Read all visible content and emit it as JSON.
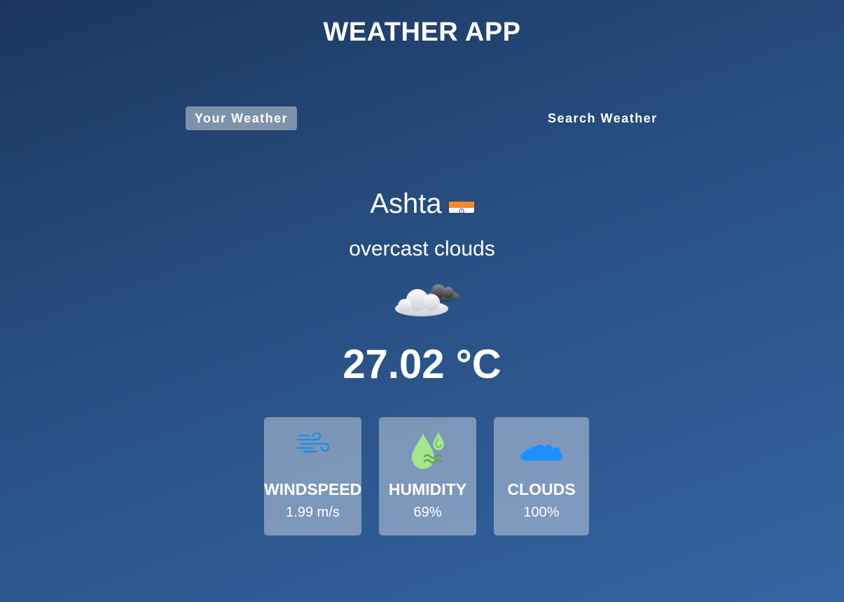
{
  "app": {
    "title": "WEATHER APP"
  },
  "tabs": [
    {
      "label": "Your Weather",
      "active": true
    },
    {
      "label": "Search Weather",
      "active": false
    }
  ],
  "weather": {
    "city": "Ashta",
    "country_flag_icon": "india-flag-icon",
    "description": "overcast clouds",
    "condition_icon": "overcast-clouds-icon",
    "temperature": "27.02 °C"
  },
  "stats": {
    "windspeed": {
      "label": "WINDSPEED",
      "value": "1.99 m/s",
      "icon": "wind-icon"
    },
    "humidity": {
      "label": "HUMIDITY",
      "value": "69%",
      "icon": "humidity-icon"
    },
    "clouds": {
      "label": "CLOUDS",
      "value": "100%",
      "icon": "clouds-icon"
    }
  },
  "colors": {
    "background_top": "#1c375f",
    "background_bottom": "#3465a2",
    "wind_icon": "#1e8fe0",
    "humidity_icon": "#a6e58c",
    "clouds_icon": "#1e8fff"
  }
}
